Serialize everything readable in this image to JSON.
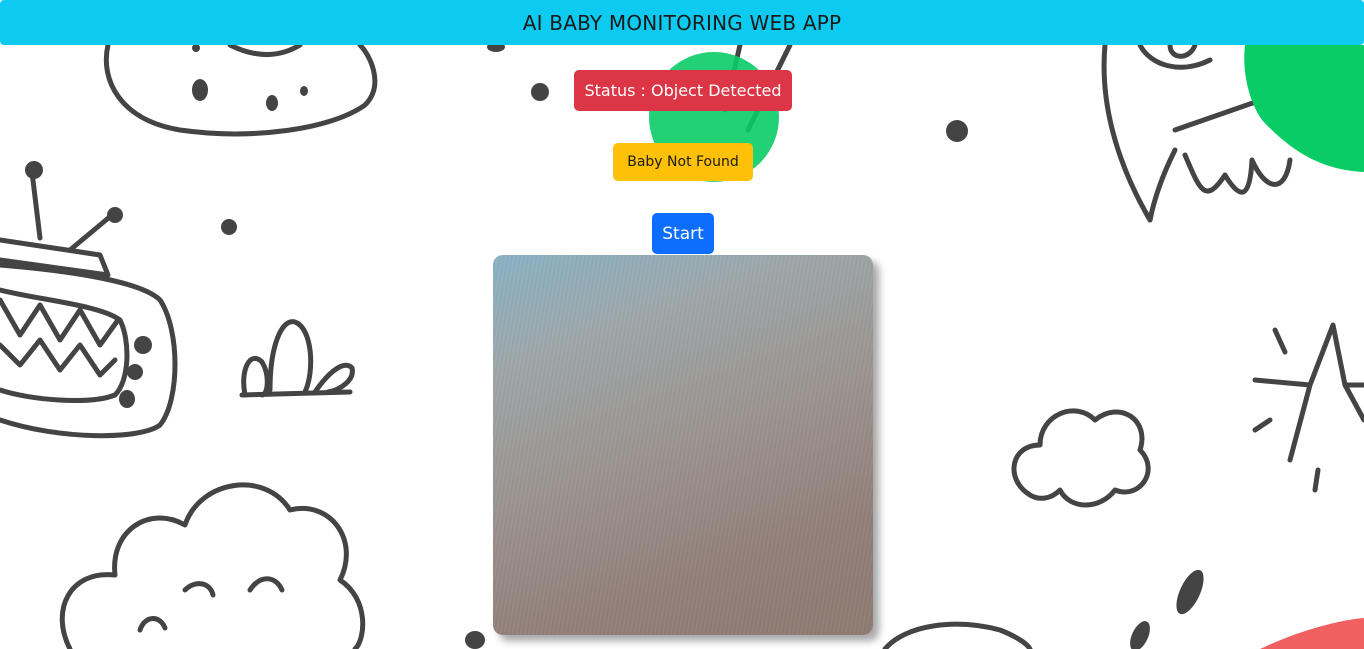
{
  "navbar": {
    "title": "AI BABY MONITORING WEB APP"
  },
  "status": {
    "label": "Status : Object Detected",
    "color": "#dc3545"
  },
  "detection": {
    "label": "Baby Not Found",
    "color": "#ffc107"
  },
  "controls": {
    "start_label": "Start",
    "color": "#0d6efd"
  },
  "video": {
    "icon": "camera-feed"
  },
  "theme": {
    "navbar_color": "#0dcaf0"
  }
}
